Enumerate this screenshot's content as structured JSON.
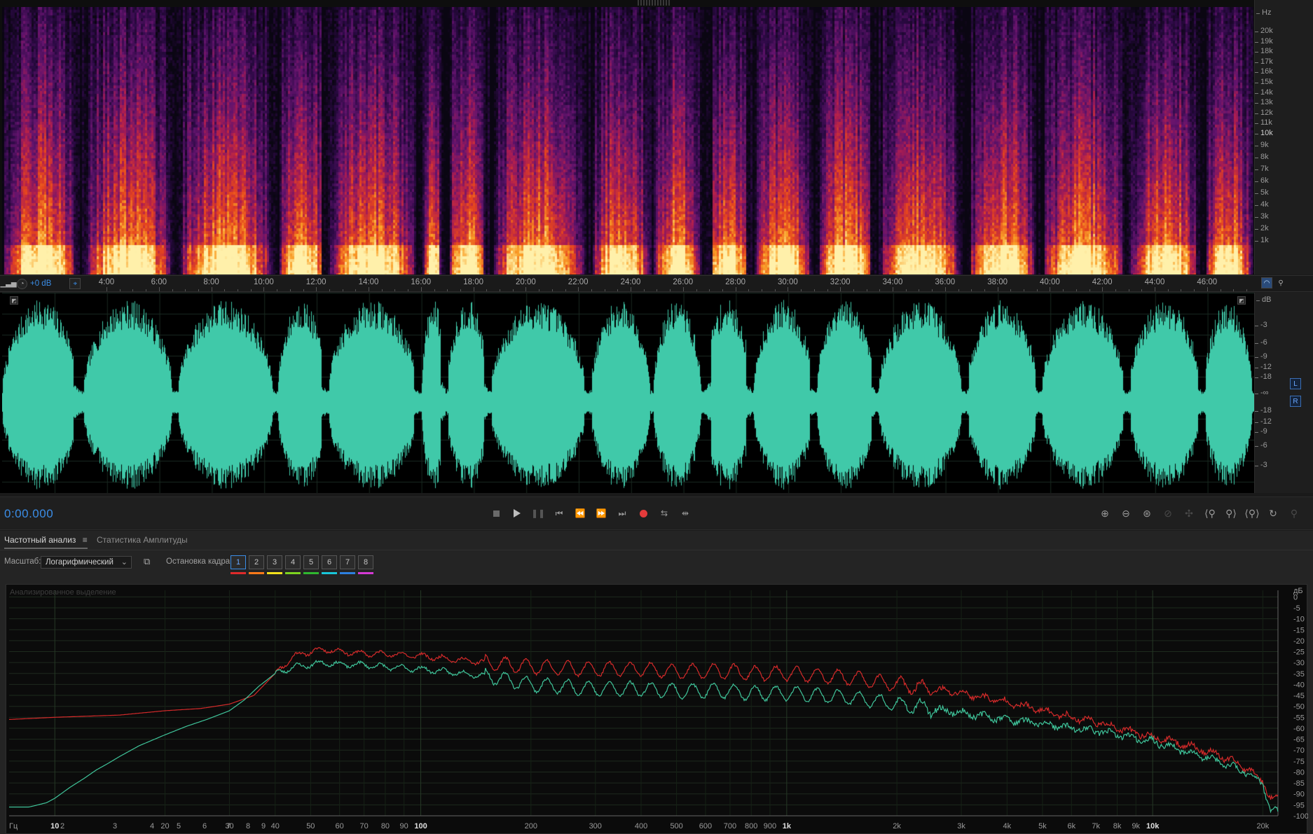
{
  "spectrogram": {
    "unit_label": "Hz",
    "freq_ticks": [
      "20k",
      "19k",
      "18k",
      "17k",
      "16k",
      "15k",
      "14k",
      "13k",
      "12k",
      "11k",
      "10k",
      "9k",
      "8k",
      "7k",
      "6k",
      "5k",
      "4k",
      "3k",
      "2k",
      "1k"
    ],
    "major_tick": "10k"
  },
  "ruler": {
    "gain_label": "+0 dB",
    "time_labels": [
      "4:00",
      "6:00",
      "8:00",
      "10:00",
      "12:00",
      "14:00",
      "16:00",
      "18:00",
      "20:00",
      "22:00",
      "24:00",
      "26:00",
      "28:00",
      "30:00",
      "32:00",
      "34:00",
      "36:00",
      "38:00",
      "40:00",
      "42:00",
      "44:00",
      "46:00",
      "4"
    ]
  },
  "waveform": {
    "unit_label": "dB",
    "db_ticks_top": [
      "-3",
      "-6",
      "-9",
      "-12",
      "-18"
    ],
    "center_label": "-∞",
    "db_ticks_bottom": [
      "-18",
      "-12",
      "-9",
      "-6",
      "-3"
    ],
    "channels": [
      "L",
      "R"
    ],
    "color": "#40c9a9"
  },
  "transport": {
    "time": "0:00.000",
    "icons": [
      "stop-icon",
      "play-icon",
      "pause-icon",
      "go-to-start-icon",
      "rewind-icon",
      "fast-forward-icon",
      "go-to-end-icon",
      "record-icon",
      "loop-icon",
      "skip-selection-icon"
    ],
    "zoom_icons": [
      "zoom-in-amplitude-icon",
      "zoom-out-amplitude-icon",
      "zoom-in-time-icon",
      "zoom-out-time-icon",
      "zoom-full-icon",
      "zoom-in-left-icon",
      "zoom-in-right-icon",
      "zoom-selection-icon",
      "zoom-reset-icon",
      "zoom-extra-icon"
    ]
  },
  "panel": {
    "tab_active": "Частотный анализ",
    "tab_inactive": "Статистика Амплитуды",
    "scale_label": "Масштаб:",
    "scale_value": "Логарифмический",
    "freeze_label": "Остановка кадра:",
    "frames": [
      "1",
      "2",
      "3",
      "4",
      "5",
      "6",
      "7",
      "8"
    ],
    "frame_colors": [
      "#e02b2b",
      "#ff7a1a",
      "#f3e11c",
      "#7dd31f",
      "#2fb82f",
      "#19c6d9",
      "#2d7fe0",
      "#d43ad4"
    ],
    "caption": "Анализированное выделение"
  },
  "chart_data": {
    "type": "line",
    "title": "",
    "x_unit_label": "Гц",
    "y_unit_label": "дБ",
    "x_scale": "log",
    "xlim": [
      7.5,
      22000
    ],
    "ylim": [
      -100,
      3
    ],
    "x_tick_labels": [
      {
        "v": 10,
        "t": "10",
        "bold": true
      },
      {
        "v": 20,
        "t": "20"
      },
      {
        "v": 30,
        "t": "30"
      },
      {
        "v": 40,
        "t": "40"
      },
      {
        "v": 50,
        "t": "50"
      },
      {
        "v": 60,
        "t": "60"
      },
      {
        "v": 70,
        "t": "70"
      },
      {
        "v": 80,
        "t": "80"
      },
      {
        "v": 90,
        "t": "90"
      },
      {
        "v": 100,
        "t": "100",
        "bold": true
      },
      {
        "v": 200,
        "t": "200"
      },
      {
        "v": 300,
        "t": "300"
      },
      {
        "v": 400,
        "t": "400"
      },
      {
        "v": 500,
        "t": "500"
      },
      {
        "v": 600,
        "t": "600"
      },
      {
        "v": 700,
        "t": "700"
      },
      {
        "v": 800,
        "t": "800"
      },
      {
        "v": 900,
        "t": "900"
      },
      {
        "v": 1000,
        "t": "1k",
        "bold": true
      },
      {
        "v": 2000,
        "t": "2k"
      },
      {
        "v": 3000,
        "t": "3k"
      },
      {
        "v": 4000,
        "t": "4k"
      },
      {
        "v": 5000,
        "t": "5k"
      },
      {
        "v": 6000,
        "t": "6k"
      },
      {
        "v": 7000,
        "t": "7k"
      },
      {
        "v": 8000,
        "t": "8k"
      },
      {
        "v": 9000,
        "t": "9k"
      },
      {
        "v": 10000,
        "t": "10k",
        "bold": true
      },
      {
        "v": 20000,
        "t": "20k"
      }
    ],
    "x_small_labels": [
      {
        "v": 2,
        "t": "2"
      },
      {
        "v": 3,
        "t": "3"
      },
      {
        "v": 4,
        "t": "4"
      },
      {
        "v": 5,
        "t": "5"
      },
      {
        "v": 6,
        "t": "6"
      },
      {
        "v": 7,
        "t": "7"
      },
      {
        "v": 8,
        "t": "8"
      },
      {
        "v": 9,
        "t": "9"
      }
    ],
    "y_ticks": [
      0,
      -5,
      -10,
      -15,
      -20,
      -25,
      -30,
      -35,
      -40,
      -45,
      -50,
      -55,
      -60,
      -65,
      -70,
      -75,
      -80,
      -85,
      -90,
      -95,
      -100
    ],
    "series": [
      {
        "color": "#d42a2a",
        "points": [
          [
            7.5,
            -56
          ],
          [
            10,
            -55
          ],
          [
            15,
            -54
          ],
          [
            20,
            -52
          ],
          [
            25,
            -51
          ],
          [
            30,
            -49
          ],
          [
            35,
            -45
          ],
          [
            40,
            -35
          ],
          [
            45,
            -27
          ],
          [
            50,
            -25
          ],
          [
            55,
            -24
          ],
          [
            60,
            -25
          ],
          [
            70,
            -26
          ],
          [
            80,
            -26
          ],
          [
            100,
            -27
          ],
          [
            150,
            -30
          ],
          [
            200,
            -32
          ],
          [
            300,
            -33
          ],
          [
            400,
            -33
          ],
          [
            500,
            -34
          ],
          [
            600,
            -34
          ],
          [
            700,
            -34
          ],
          [
            800,
            -35
          ],
          [
            1000,
            -35
          ],
          [
            1500,
            -37
          ],
          [
            2000,
            -40
          ],
          [
            3000,
            -44
          ],
          [
            4000,
            -48
          ],
          [
            5000,
            -52
          ],
          [
            6000,
            -55
          ],
          [
            7000,
            -57
          ],
          [
            8000,
            -60
          ],
          [
            10000,
            -64
          ],
          [
            12000,
            -67
          ],
          [
            15000,
            -72
          ],
          [
            18000,
            -78
          ],
          [
            20000,
            -84
          ],
          [
            21000,
            -92
          ]
        ]
      },
      {
        "color": "#3fc49a",
        "points": [
          [
            7.5,
            -96
          ],
          [
            8,
            -96
          ],
          [
            8.5,
            -96
          ],
          [
            9,
            -95
          ],
          [
            9.5,
            -94
          ],
          [
            10,
            -92
          ],
          [
            11,
            -87
          ],
          [
            12,
            -83
          ],
          [
            13,
            -79
          ],
          [
            14,
            -76
          ],
          [
            15,
            -73
          ],
          [
            17,
            -68
          ],
          [
            20,
            -63
          ],
          [
            23,
            -59
          ],
          [
            26,
            -56
          ],
          [
            30,
            -52
          ],
          [
            33,
            -47
          ],
          [
            36,
            -41
          ],
          [
            40,
            -35
          ],
          [
            45,
            -32
          ],
          [
            50,
            -31
          ],
          [
            55,
            -30
          ],
          [
            60,
            -31
          ],
          [
            70,
            -31
          ],
          [
            80,
            -32
          ],
          [
            100,
            -33
          ],
          [
            150,
            -36
          ],
          [
            200,
            -40
          ],
          [
            300,
            -42
          ],
          [
            400,
            -42
          ],
          [
            500,
            -43
          ],
          [
            600,
            -43
          ],
          [
            700,
            -43
          ],
          [
            800,
            -44
          ],
          [
            1000,
            -44
          ],
          [
            1500,
            -46
          ],
          [
            2000,
            -49
          ],
          [
            3000,
            -53
          ],
          [
            4000,
            -56
          ],
          [
            5000,
            -58
          ],
          [
            6000,
            -60
          ],
          [
            7000,
            -61
          ],
          [
            8000,
            -63
          ],
          [
            10000,
            -66
          ],
          [
            12000,
            -70
          ],
          [
            15000,
            -75
          ],
          [
            18000,
            -80
          ],
          [
            20000,
            -85
          ],
          [
            21000,
            -98
          ]
        ]
      }
    ]
  }
}
